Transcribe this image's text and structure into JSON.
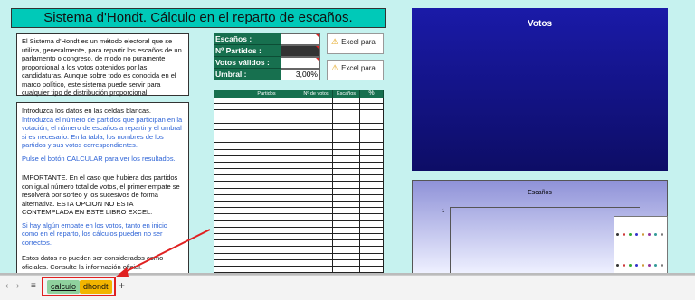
{
  "title": "Sistema d'Hondt. Cálculo en el reparto de escaños.",
  "intro": "El Sistema d'Hondt es un método electoral que se utiliza, generalmente, para repartir los escaños de un parlamento o congreso, de modo no puramente proporcional a los votos obtenidos por las candidaturas. Aunque sobre todo es conocida en el marco político, este sistema puede servir para cualquier tipo de distribución proporcional.",
  "instructions": {
    "p1": "Introduzca los datos en las celdas blancas.",
    "p2": "Introduzca el número de partidos que participan en la votación, el número de escaños a repartir y el umbral si es necesario. En la tabla, los nombres de los partidos y sus votos correspondientes.",
    "p3": "Pulse el botón CALCULAR para ver los resultados.",
    "p4": "IMPORTANTE. En el caso que hubiera dos partidos con igual número total de votos, el primer empate se resolverá por sorteo y los sucesivos de forma alternativa. ESTA OPCION NO ESTA CONTEMPLADA EN ESTE LIBRO EXCEL.",
    "p5": "Si hay algún empate en los votos, tanto en inicio como en el reparto, los cálculos pueden no ser correctos.",
    "p6": "Estos datos no pueden ser considerados como oficiales. Consulte la información oficial."
  },
  "inputs": {
    "escanos_label": "Escaños     :",
    "partidos_label": "Nº  Partidos  :",
    "votos_label": "Votos válidos  :",
    "umbral_label": "Umbral        :",
    "umbral_value": "3,00%"
  },
  "excel_button_label": "Excel para",
  "grid_headers": [
    "Partidos",
    "Nº de votos",
    "Escaños",
    "%"
  ],
  "votos_title": "Votos",
  "escanos_title": "Escaños",
  "escanos_axis_tick": "1",
  "sheet_tabs": [
    "calculo",
    "dhondt"
  ],
  "add_sheet": "+"
}
